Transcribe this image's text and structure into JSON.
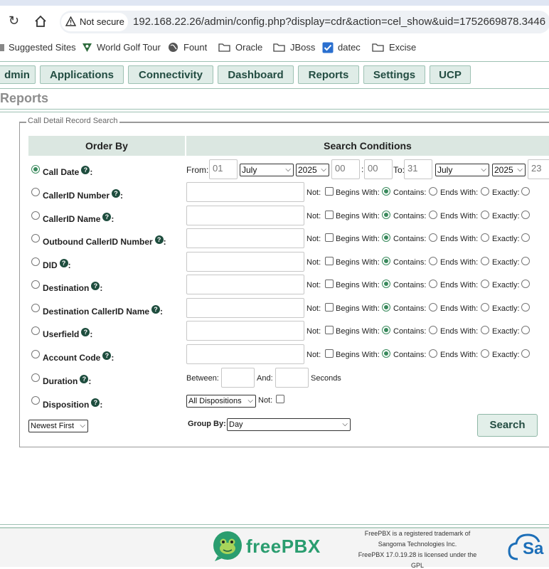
{
  "browser": {
    "security_label": "Not secure",
    "url": "192.168.22.26/admin/config.php?display=cdr&action=cel_show&uid=1752669878.3446",
    "bookmarks": [
      {
        "label": "Suggested Sites",
        "icon": "suggested-icon"
      },
      {
        "label": "World Golf Tour",
        "icon": "golf-icon"
      },
      {
        "label": "Fount",
        "icon": "globe-icon"
      },
      {
        "label": "Oracle",
        "icon": "folder-icon"
      },
      {
        "label": "JBoss",
        "icon": "folder-icon"
      },
      {
        "label": "datec",
        "icon": "checkbox-icon"
      },
      {
        "label": "Excise",
        "icon": "folder-icon"
      }
    ]
  },
  "nav": {
    "items": [
      "dmin",
      "Applications",
      "Connectivity",
      "Dashboard",
      "Reports",
      "Settings",
      "UCP"
    ]
  },
  "page": {
    "title": "Reports",
    "legend": "Call Detail Record Search"
  },
  "table": {
    "order_by_header": "Order By",
    "conditions_header": "Search Conditions",
    "rows": [
      {
        "label": "Call Date"
      },
      {
        "label": "CallerID Number"
      },
      {
        "label": "CallerID Name"
      },
      {
        "label": "Outbound CallerID Number"
      },
      {
        "label": "DID"
      },
      {
        "label": "Destination"
      },
      {
        "label": "Destination CallerID Name"
      },
      {
        "label": "Userfield"
      },
      {
        "label": "Account Code"
      },
      {
        "label": "Duration"
      },
      {
        "label": "Disposition"
      }
    ],
    "selected_order": "Call Date",
    "match_labels": {
      "not": "Not:",
      "begins": "Begins With:",
      "contains": "Contains:",
      "ends": "Ends With:",
      "exactly": "Exactly:"
    },
    "date": {
      "from_label": "From:",
      "from_day": "01",
      "from_month": "July",
      "from_year": "2025",
      "from_hour": "00",
      "from_min": "00",
      "to_label": "To:",
      "to_day": "31",
      "to_month": "July",
      "to_year": "2025",
      "to_hour": "23"
    },
    "duration": {
      "between_label": "Between:",
      "and_label": "And:",
      "unit": "Seconds"
    },
    "disposition": {
      "value": "All Dispositions",
      "not_label": "Not:"
    }
  },
  "bottom": {
    "sort_value": "Newest First",
    "group_by_label": "Group By:",
    "group_by_value": "Day",
    "search_label": "Search"
  },
  "footer": {
    "logo_text": "freePBX",
    "line1": "FreePBX is a registered trademark of",
    "line2": "Sangoma Technologies Inc.",
    "line3": "FreePBX 17.0.19.28 is licensed under the",
    "line4": "GPL",
    "sangoma_partial": "Sa"
  },
  "colors": {
    "accent": "#3a8a5d",
    "nav_bg": "#dfece7",
    "header_bg": "#dbe7e1",
    "help_icon": "#1e4d3e"
  }
}
